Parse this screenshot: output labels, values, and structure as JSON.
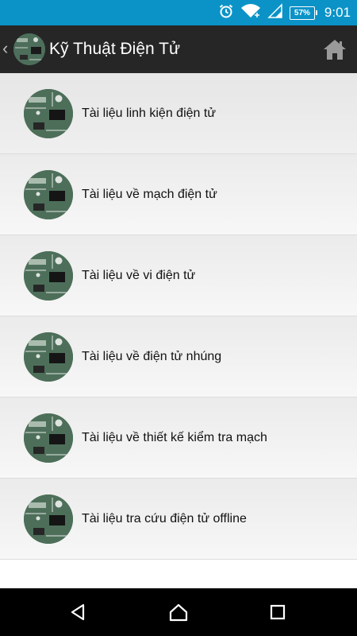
{
  "status_bar": {
    "battery": "57%",
    "time": "9:01",
    "icons": [
      "alarm-icon",
      "wifi-icon",
      "signal-icon",
      "battery-icon"
    ]
  },
  "app_bar": {
    "title": "Kỹ Thuật Điện Tử",
    "icons": [
      "back-icon",
      "circuit-board-logo",
      "home-icon"
    ]
  },
  "list": {
    "items": [
      {
        "label": "Tài liệu linh kiện điện tử"
      },
      {
        "label": "Tài liệu về mạch điện tử"
      },
      {
        "label": "Tài liệu về vi điện tử"
      },
      {
        "label": "Tài liệu về điện tử nhúng"
      },
      {
        "label": "Tài liệu về thiết kế kiểm tra mạch"
      },
      {
        "label": "Tài liệu tra cứu điện tử offline"
      }
    ]
  },
  "nav_bar": {
    "icons": [
      "back-triangle-icon",
      "home-outline-icon",
      "recents-square-icon"
    ]
  },
  "colors": {
    "status_bar": "#0b93c7",
    "app_bar": "#262626",
    "list_background": "#efefef",
    "nav_bar": "#000000"
  }
}
